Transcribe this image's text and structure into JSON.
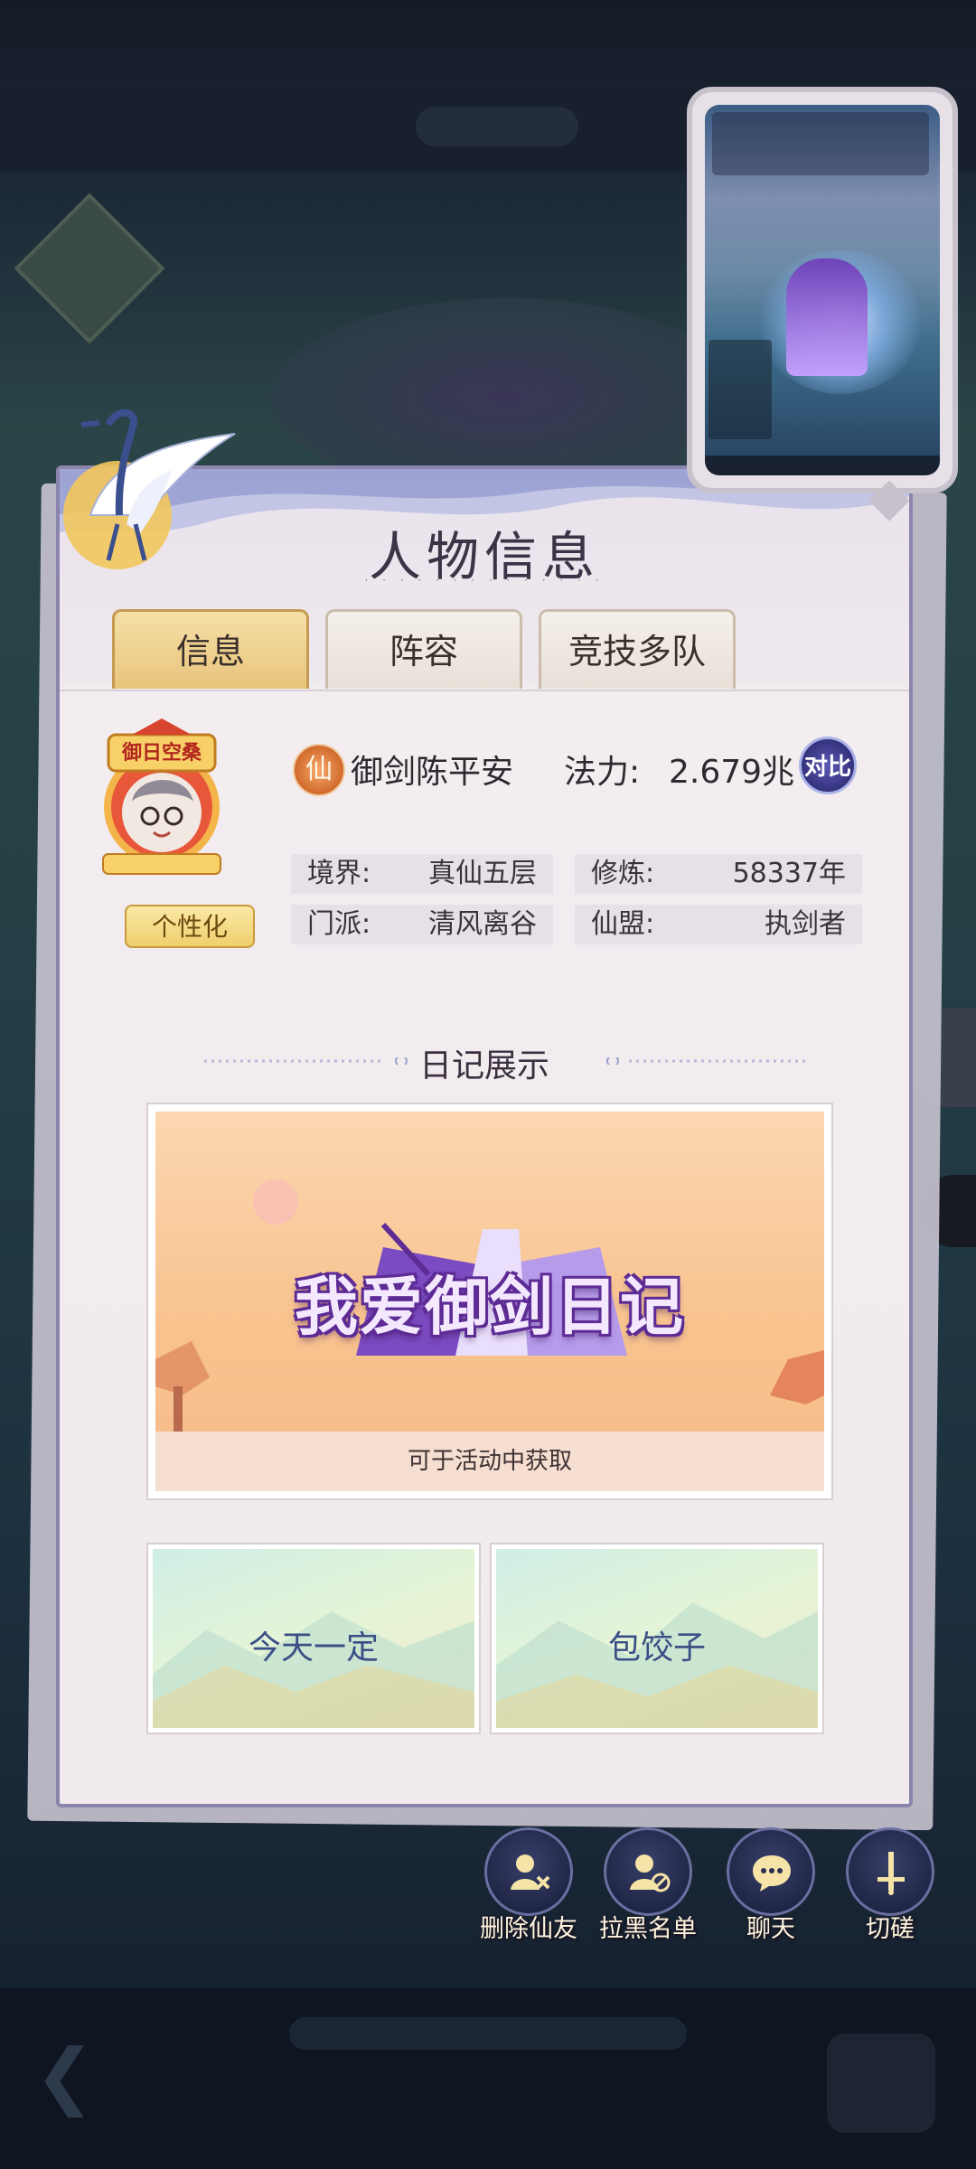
{
  "panel": {
    "title": "人物信息",
    "tabs": [
      {
        "label": "信息",
        "active": true
      },
      {
        "label": "阵容",
        "active": false
      },
      {
        "label": "竞技多队",
        "active": false
      }
    ]
  },
  "profile": {
    "avatar_frame_text": "御日空桑",
    "personalize_label": "个性化",
    "badge_char": "仙",
    "name": "御剑陈平安",
    "power_label": "法力:",
    "power_value": "2.679兆",
    "compare_label": "对比",
    "stats": [
      {
        "label": "境界:",
        "value": "真仙五层"
      },
      {
        "label": "修炼:",
        "value": "58337年"
      },
      {
        "label": "门派:",
        "value": "清风离谷"
      },
      {
        "label": "仙盟:",
        "value": "执剑者"
      }
    ]
  },
  "diary": {
    "heading": "日记展示",
    "card_title": "我爱御剑日记",
    "card_caption": "可于活动中获取",
    "signatures": [
      "今天一定",
      "包饺子"
    ]
  },
  "actions": [
    {
      "label": "删除仙友",
      "icon": "remove-friend-icon"
    },
    {
      "label": "拉黑名单",
      "icon": "block-user-icon"
    },
    {
      "label": "聊天",
      "icon": "chat-icon"
    },
    {
      "label": "切磋",
      "icon": "sword-icon"
    }
  ],
  "colors": {
    "accent_gold": "#efcf6d",
    "panel_border": "#8b84ad",
    "tab_active": "#e8c57c",
    "compare_blue": "#2f2d74"
  }
}
